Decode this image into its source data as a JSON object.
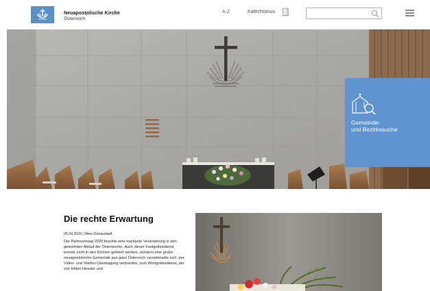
{
  "header": {
    "brand_name": "Neuapostolische Kirche",
    "brand_sub": "Österreich",
    "nav_az": "A-Z",
    "nav_katechismus": "Katechismus",
    "search_placeholder": ""
  },
  "hero": {
    "tile_text_line1": "Gemeinde-",
    "tile_text_line2": "und Bezirkssuche"
  },
  "article": {
    "title": "Die rechte Erwartung",
    "meta": "05.04.2020 | Wien-Donaustadt",
    "body": "Der Palmsonntag 2020 brachte eine markante Veränderung in den gewohnten Ablauf der Osterwoche. Auch dieser Festgottesdienst konnte nicht in den Kirchen gefeiert werden, sondern eine große neuapostolische Gemeinde aus ganz Österreich versammelte sich, per Video- und Telefon-Übertragung verbunden, zum Wortgottesdienst, der von Hirten Hessler und"
  },
  "colors": {
    "brand_blue": "#5b8fc9",
    "tile_blue": "#5e93cf"
  },
  "icons": [
    "logo-emblem-icon",
    "book-icon",
    "search-icon",
    "menu-icon",
    "church-search-icon"
  ]
}
